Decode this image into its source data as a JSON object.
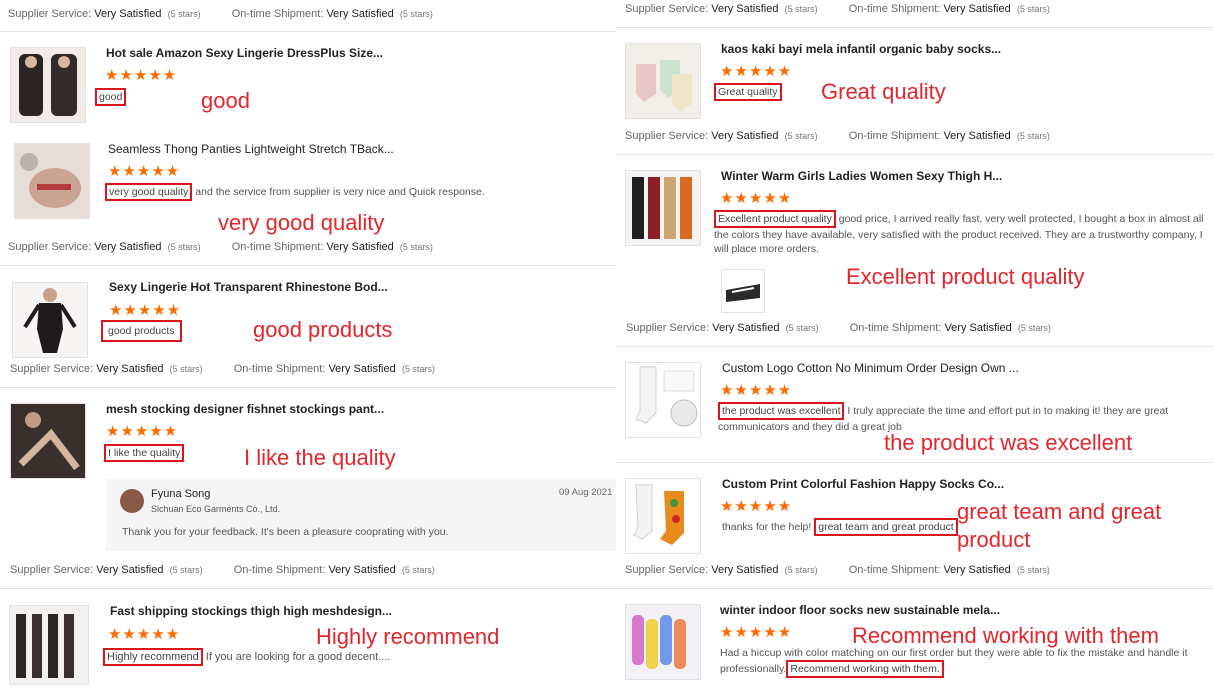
{
  "supplier_labels": {
    "service": "Supplier Service:",
    "service_value": "Very Satisfied",
    "shipment": "On-time Shipment:",
    "shipment_value": "Very Satisfied",
    "stars_note": "(5 stars)"
  },
  "stars": "★★★★★",
  "left": {
    "r1": {
      "title": "Hot sale Amazon Sexy Lingerie DressPlus Size...",
      "review_hl": "good",
      "annot": "good"
    },
    "r2": {
      "title": "Seamless Thong Panties Lightweight Stretch TBack...",
      "review_hl": "very good quality",
      "review_rest": " and the service from supplier is very nice and Quick response.",
      "annot": "very good quality"
    },
    "r3": {
      "title": "Sexy Lingerie Hot Transparent Rhinestone Bod...",
      "review_hl": "good products",
      "annot": "good products"
    },
    "r4": {
      "title": "mesh stocking designer fishnet stockings pant...",
      "review_hl": "I like the quality",
      "annot": "I like the quality",
      "reply": {
        "name": "Fyuna Song",
        "company": "Sichuan Eco Garments Co., Ltd.",
        "date": "09 Aug 2021",
        "text": "Thank you for your feedback. It's been a pleasure cooprating with you."
      }
    },
    "r5": {
      "title": "Fast shipping stockings thigh high meshdesign...",
      "review_hl": "Highly recommend",
      "review_rest": " If you are looking for a good decent....",
      "annot": "Highly recommend"
    }
  },
  "right": {
    "r1": {
      "title": "kaos kaki bayi mela infantil organic baby socks...",
      "review_hl": "Great quality",
      "annot": "Great quality"
    },
    "r2": {
      "title": "Winter Warm Girls Ladies Women Sexy Thigh H...",
      "review_hl": "Excellent product quality",
      "review_rest": " good price, I arrived really fast, very well protected, I bought a box in almost all the colors they have available, very satisfied with the product received.  They are a trustworthy company, I will place more orders.",
      "annot": "Excellent product quality"
    },
    "r3": {
      "title": "Custom Logo Cotton No Minimum Order Design Own ...",
      "review_hl": "the product was excellent",
      "review_rest": " I truly appreciate the time and effort put in to making it! they are great communicators and they did a great job",
      "annot": "the product was excellent"
    },
    "r4": {
      "title": "Custom Print Colorful Fashion Happy Socks Co...",
      "review_pre": "thanks for the help! ",
      "review_hl": "great team and great product",
      "annot_l1": "great team and great",
      "annot_l2": "product"
    },
    "r5": {
      "title": "winter indoor floor socks new sustainable mela...",
      "review_pre": "Had a hiccup with color matching on our first order but they were able to fix the mistake and handle it professionally.",
      "review_hl": "Recommend working with them.",
      "annot": "Recommend working with them"
    }
  },
  "colors": {
    "accent_red": "#e3262b",
    "star_orange": "#ff6a00"
  }
}
